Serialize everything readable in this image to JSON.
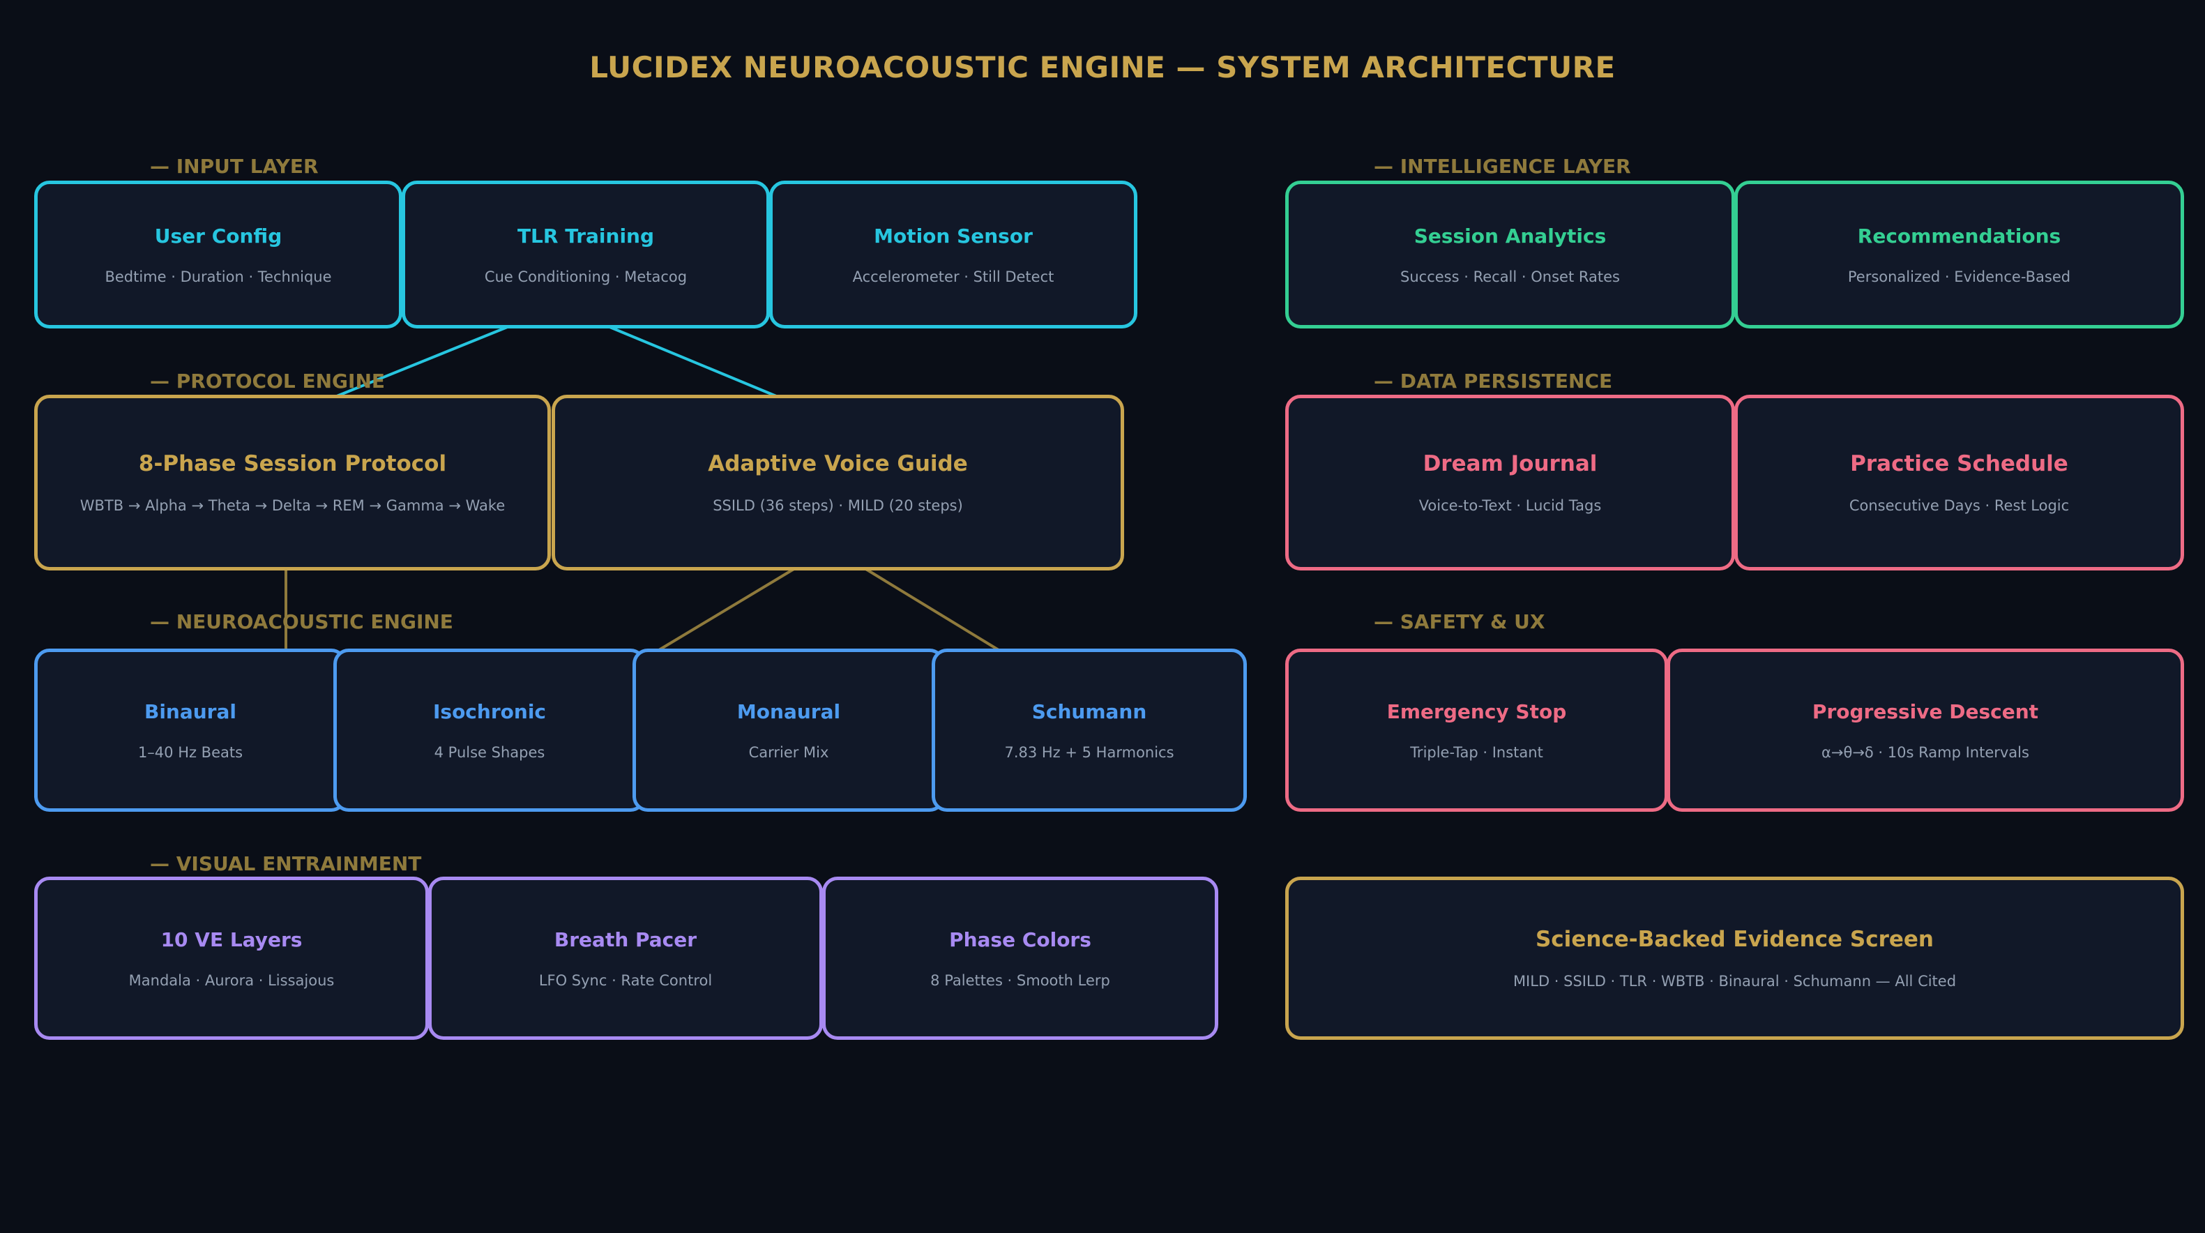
{
  "title": "LUCIDEX NEUROACOUSTIC ENGINE — SYSTEM ARCHITECTURE",
  "colors": {
    "background": "#0a0e17",
    "node_fill": "#111828",
    "title_gold": "#c9a54e",
    "section_label": "#8f7a3c",
    "input_cyan": "#27c6e0",
    "intelligence_green": "#34cf93",
    "protocol_gold": "#c9a54e",
    "persistence_pink": "#ee6b85",
    "neuroacoustic_blue": "#4d9bf0",
    "visual_purple": "#a88af2",
    "subtitle_gray": "#94a0b2"
  },
  "sections": {
    "input": "— INPUT LAYER",
    "protocol": "— PROTOCOL ENGINE",
    "neuroacoustic": "— NEUROACOUSTIC ENGINE",
    "visual": "— VISUAL ENTRAINMENT",
    "intelligence": "— INTELLIGENCE LAYER",
    "persistence": "— DATA PERSISTENCE",
    "safety": "— SAFETY & UX"
  },
  "nodes": {
    "user_config": {
      "title": "User Config",
      "subtitle": "Bedtime · Duration · Technique"
    },
    "tlr_training": {
      "title": "TLR Training",
      "subtitle": "Cue Conditioning · Metacog"
    },
    "motion_sensor": {
      "title": "Motion Sensor",
      "subtitle": "Accelerometer · Still Detect"
    },
    "session_analytics": {
      "title": "Session Analytics",
      "subtitle": "Success · Recall · Onset Rates"
    },
    "recommendations": {
      "title": "Recommendations",
      "subtitle": "Personalized · Evidence-Based"
    },
    "session_protocol": {
      "title": "8-Phase Session Protocol",
      "subtitle": "WBTB → Alpha → Theta → Delta → REM → Gamma → Wake"
    },
    "voice_guide": {
      "title": "Adaptive Voice Guide",
      "subtitle": "SSILD (36 steps) · MILD (20 steps)"
    },
    "dream_journal": {
      "title": "Dream Journal",
      "subtitle": "Voice-to-Text · Lucid Tags"
    },
    "practice_schedule": {
      "title": "Practice Schedule",
      "subtitle": "Consecutive Days · Rest Logic"
    },
    "binaural": {
      "title": "Binaural",
      "subtitle": "1–40 Hz Beats"
    },
    "isochronic": {
      "title": "Isochronic",
      "subtitle": "4 Pulse Shapes"
    },
    "monaural": {
      "title": "Monaural",
      "subtitle": "Carrier Mix"
    },
    "schumann": {
      "title": "Schumann",
      "subtitle": "7.83 Hz + 5 Harmonics"
    },
    "emergency_stop": {
      "title": "Emergency Stop",
      "subtitle": "Triple-Tap · Instant"
    },
    "progressive_descent": {
      "title": "Progressive Descent",
      "subtitle": "α→θ→δ · 10s Ramp Intervals"
    },
    "ve_layers": {
      "title": "10 VE Layers",
      "subtitle": "Mandala · Aurora · Lissajous"
    },
    "breath_pacer": {
      "title": "Breath Pacer",
      "subtitle": "LFO Sync · Rate Control"
    },
    "phase_colors": {
      "title": "Phase Colors",
      "subtitle": "8 Palettes · Smooth Lerp"
    },
    "evidence_screen": {
      "title": "Science-Backed Evidence Screen",
      "subtitle": "MILD · SSILD · TLR · WBTB · Binaural · Schumann — All Cited"
    }
  }
}
